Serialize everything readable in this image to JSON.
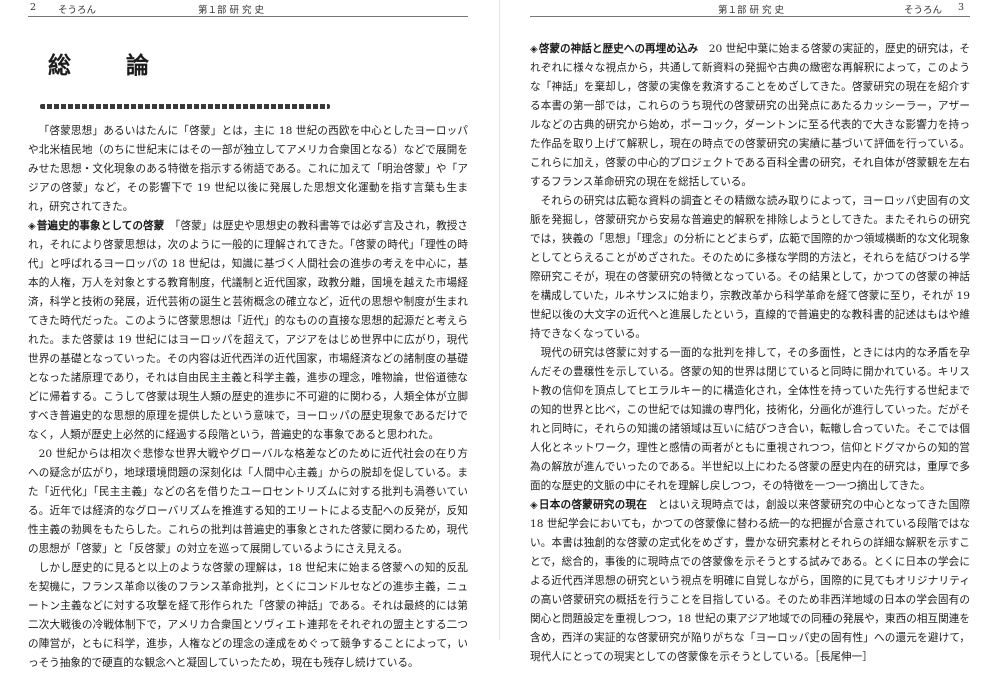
{
  "left_page": {
    "page_number": "2",
    "running_title": "そうろん",
    "part_title": "第１部 研 究 史",
    "chapter_title": "総　論",
    "paragraphs": [
      {
        "heading": "",
        "text": "「啓蒙思想」あるいはたんに「啓蒙」とは，主に 18 世紀の西欧を中心としたヨーロッパや北米植民地（のちに世紀末にはその一部が独立してアメリカ合衆国となる）などで展開をみせた思想・文化現象のある特徴を指示する術語である。これに加えて「明治啓蒙」や「アジアの啓蒙」など，その影響下で 19 世紀以後に発展した思想文化運動を指す言葉も生まれ，研究されてきた。"
      },
      {
        "heading": "普遍史的事象としての啓蒙",
        "text": "「啓蒙」は歴史や思想史の教科書等では必ず言及され，教授され，それにより啓蒙思想は，次のように一般的に理解されてきた。「啓蒙の時代」「理性の時代」と呼ばれるヨーロッパの 18 世紀は，知識に基づく人間社会の進歩の考えを中心に，基本的人権，万人を対象とする教育制度，代議制と近代国家，政教分離，国境を越えた市場経済，科学と技術の発展，近代芸術の誕生と芸術概念の確立など，近代の思想や制度が生まれてきた時代だった。このように啓蒙思想は「近代」的なものの直接な思想的起源だと考えられた。また啓蒙は 19 世紀にはヨーロッパを超えて，アジアをはじめ世界中に広がり，現代世界の基礎となっていった。その内容は近代西洋の近代国家，市場経済などの諸制度の基礎となった諸原理であり，それは自由民主主義と科学主義，進歩の理念，唯物論，世俗道徳などに帰着する。こうして啓蒙は現生人類の歴史的進歩に不可避的に関わる，人類全体が立脚すべき普遍史的な思想的原理を提供したという意味で，ヨーロッパの歴史現象であるだけでなく，人類が歴史上必然的に経過する段階という，普遍史的な事象であると思われた。"
      },
      {
        "heading": "",
        "text": "20 世紀からは相次ぐ悲惨な世界大戦やグローバルな格差などのために近代社会の在り方への疑念が広がり，地球環境問題の深刻化は「人間中心主義」からの脱却を促している。また「近代化」「民主主義」などの名を借りたユーロセントリズムに対する批判も渦巻いている。近年では経済的なグローバリズムを推進する知的エリートによる支配への反発が，反知性主義の勃興をもたらした。これらの批判は普遍史的事象とされた啓蒙に関わるため，現代の思想が「啓蒙」と「反啓蒙」の対立を巡って展開しているようにさえ見える。"
      },
      {
        "heading": "",
        "text": "しかし歴史的に見ると以上のような啓蒙の理解は，18 世紀末に始まる啓蒙への知的反乱を契機に，フランス革命以後のフランス革命批判，とくにコンドルセなどの進歩主義，ニュートン主義などに対する攻撃を経て形作られた「啓蒙の神話」である。それは最終的には第二次大戦後の冷戦体制下で，アメリカ合衆国とソヴィエト連邦をそれぞれの盟主とする二つの陣営が，ともに科学，進歩，人権などの理念の達成をめぐって競争することによって，いっそう抽象的で硬直的な観念へと凝固していったため，現在も残存し続けている。"
      }
    ]
  },
  "right_page": {
    "page_number": "3",
    "running_title": "そうろん",
    "part_title": "第１部 研 究 史",
    "paragraphs": [
      {
        "heading": "啓蒙の神話と歴史への再埋め込み",
        "text": "20 世紀中葉に始まる啓蒙の実証的，歴史的研究は，それぞれに様々な視点から，共通して新資料の発掘や古典の緻密な再解釈によって，このような「神話」を棄却し，啓蒙の実像を救済することをめざしてきた。啓蒙研究の現在を紹介する本書の第一部では，これらのうち現代の啓蒙研究の出発点にあたるカッシーラー，アザールなどの古典的研究から始め，ポーコック，ダーントンに至る代表的で大きな影響力を持った作品を取り上げて解釈し，現在の時点での啓蒙研究の実績に基づいて評価を行っている。これらに加え，啓蒙の中心的プロジェクトである百科全書の研究，それ自体が啓蒙観を左右するフランス革命研究の現在を総括している。"
      },
      {
        "heading": "",
        "text": "それらの研究は広範な資料の調査とその精緻な読み取りによって，ヨーロッパ史固有の文脈を発掘し，啓蒙研究から安易な普遍史的解釈を排除しようとしてきた。またそれらの研究では，狭義の「思想」「理念」の分析にとどまらず，広範で国際的かつ領域横断的な文化現象としてとらえることがめざされた。そのために多様な学問的方法と，それらを結びつける学際研究こそが，現在の啓蒙研究の特徴となっている。その結果として，かつての啓蒙の神話を構成していた，ルネサンスに始まり，宗教改革から科学革命を経て啓蒙に至り，それが 19 世紀以後の大文字の近代へと進展したという，直線的で普遍史的な教科書的記述はもはや維持できなくなっている。"
      },
      {
        "heading": "",
        "text": "現代の研究は啓蒙に対する一面的な批判を排して，その多面性，ときには内的な矛盾を孕んだその豊穣性を示している。啓蒙の知的世界は閉じていると同時に開かれている。キリスト教の信仰を頂点してヒエラルキー的に構造化され，全体性を持っていた先行する世紀までの知的世界と比べ，この世紀では知識の専門化，技術化，分画化が進行していった。だがそれと同時に，それらの知識の諸領域は互いに結びつき合い，転轍し合っていた。そこでは個人化とネットワーク，理性と感情の両者がともに重視されつつ，信仰とドグマからの知的営為の解放が進んでいったのである。半世紀以上にわたる啓蒙の歴史内在的研究は，重厚で多面的な歴史的文脈の中にそれを理解し戻しつつ，その特徴を一つ一つ摘出してきた。"
      },
      {
        "heading": "日本の啓蒙研究の現在",
        "text": "とはいえ現時点では，創設以来啓蒙研究の中心となってきた国際 18 世紀学会においても，かつての啓蒙像に替わる統一的な把握が合意されている段階ではない。本書は独創的な啓蒙の定式化をめざす，豊かな研究素材とそれらの詳細な解釈を示すことで，総合的，事後的に現時点での啓蒙像を示そうとする試みである。とくに日本の学会による近代西洋思想の研究という視点を明確に自覚しながら，国際的に見てもオリジナリティの高い啓蒙研究の概括を行うことを目指している。そのため非西洋地域の日本の学会固有の関心と問題設定を重視しつつ，18 世紀の東アジア地域での同種の発展や，東西の相互関連を含め，西洋の実証的な啓蒙研究が陥りがちな「ヨーロッパ史の固有性」への還元を避けて，現代人にとっての現実としての啓蒙像を示そうとしている。［長尾伸一］"
      }
    ]
  }
}
